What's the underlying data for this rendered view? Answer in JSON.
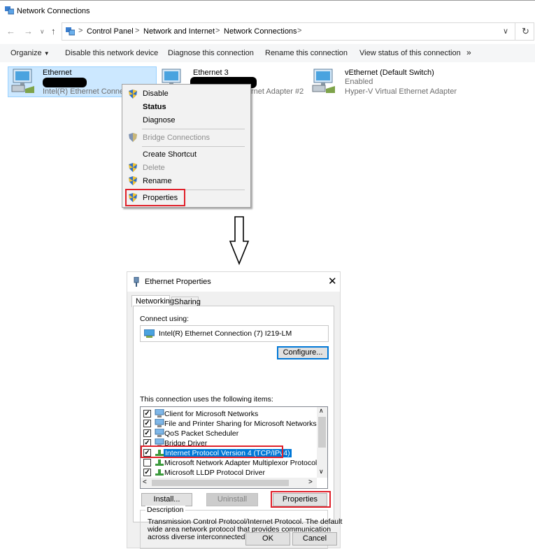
{
  "window": {
    "title": "Network Connections"
  },
  "address": {
    "crumbs": [
      "Control Panel",
      "Network and Internet",
      "Network Connections"
    ]
  },
  "toolbar": {
    "organize": "Organize",
    "commands": [
      "Disable this network device",
      "Diagnose this connection",
      "Rename this connection",
      "View status of this connection"
    ],
    "more": "»"
  },
  "adapters": [
    {
      "name": "Ethernet",
      "status": "",
      "device": "Intel(R) Ethernet Connect"
    },
    {
      "name": "Ethernet 3",
      "status": "",
      "device": "rnet Adapter #2"
    },
    {
      "name": "vEthernet (Default Switch)",
      "status": "Enabled",
      "device": "Hyper-V Virtual Ethernet Adapter"
    }
  ],
  "context_menu": {
    "items": [
      "Disable",
      "Status",
      "Diagnose",
      "Bridge Connections",
      "Create Shortcut",
      "Delete",
      "Rename",
      "Properties"
    ]
  },
  "arrow_icon": "down-arrow-icon",
  "dialog": {
    "title": "Ethernet Properties",
    "tabs": [
      "Networking",
      "Sharing"
    ],
    "connect_using_label": "Connect using:",
    "adapter": "Intel(R) Ethernet Connection (7) I219-LM",
    "configure_label": "Configure...",
    "items_label": "This connection uses the following items:",
    "items": [
      {
        "label": "Client for Microsoft Networks",
        "checked": true
      },
      {
        "label": "File and Printer Sharing for Microsoft Networks",
        "checked": true
      },
      {
        "label": "QoS Packet Scheduler",
        "checked": true
      },
      {
        "label": "Bridge Driver",
        "checked": true
      },
      {
        "label": "Internet Protocol Version 4 (TCP/IPv4)",
        "checked": true,
        "selected": true
      },
      {
        "label": "Microsoft Network Adapter Multiplexor Protocol",
        "checked": false
      },
      {
        "label": "Microsoft LLDP Protocol Driver",
        "checked": true
      }
    ],
    "install_label": "Install...",
    "uninstall_label": "Uninstall",
    "properties_label": "Properties",
    "description_label": "Description",
    "description_lines": [
      "Transmission Control Protocol/Internet Protocol. The default",
      "wide area network protocol that provides communication",
      "across diverse interconnected networks."
    ],
    "ok_label": "OK",
    "cancel_label": "Cancel"
  },
  "colors": {
    "highlight": "#cce8ff",
    "accent": "#0078d7",
    "callout_red": "#e0202a"
  }
}
